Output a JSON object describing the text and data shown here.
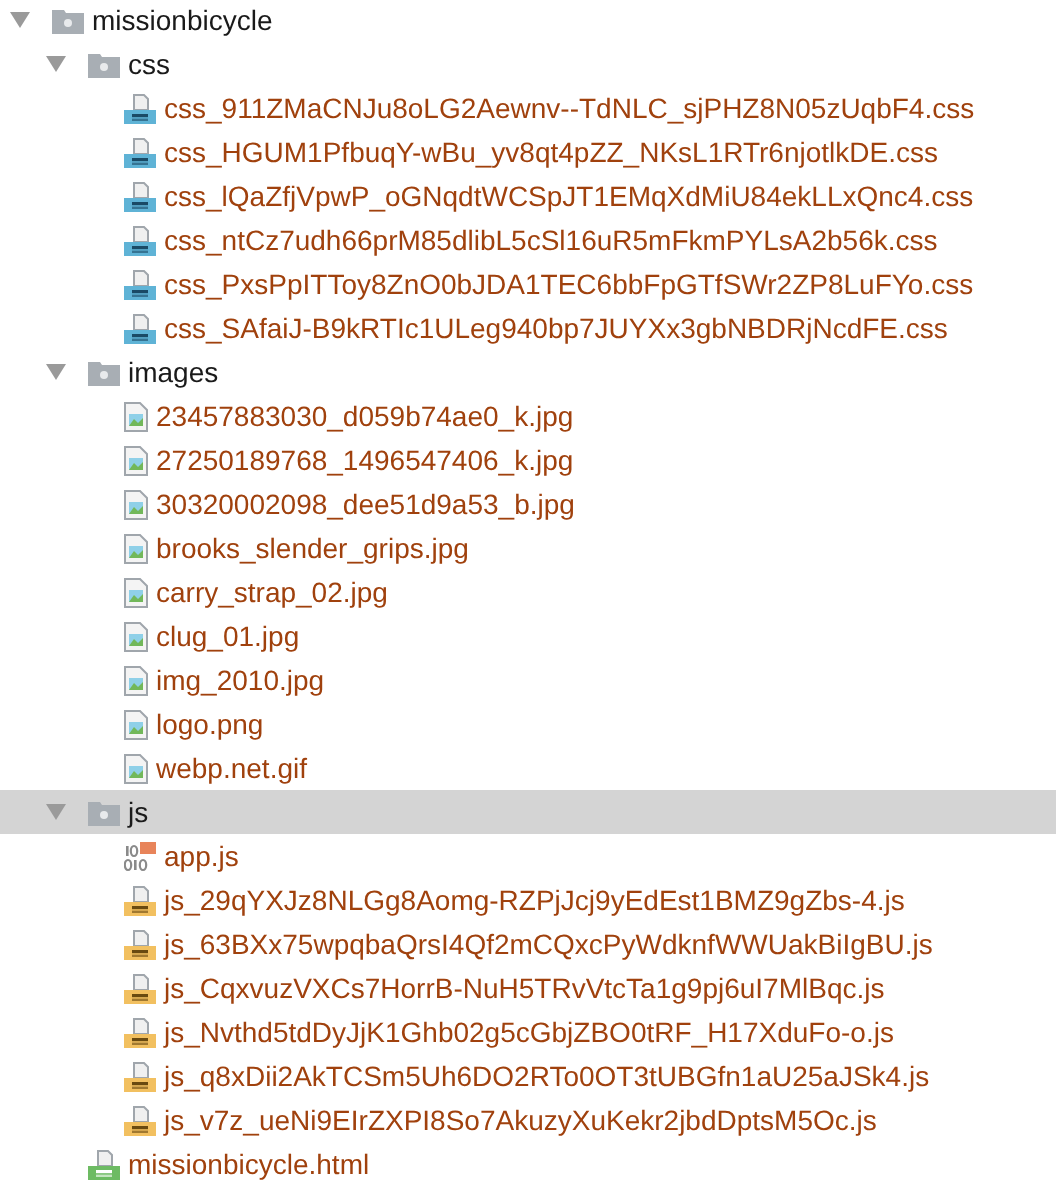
{
  "tree": [
    {
      "kind": "folder",
      "name": "missionbicycle",
      "expanded": true,
      "selected": false,
      "children": [
        {
          "kind": "folder",
          "name": "css",
          "expanded": true,
          "selected": false,
          "children": [
            {
              "kind": "css",
              "name": "css_911ZMaCNJu8oLG2Aewnv--TdNLC_sjPHZ8N05zUqbF4.css",
              "selected": false
            },
            {
              "kind": "css",
              "name": "css_HGUM1PfbuqY-wBu_yv8qt4pZZ_NKsL1RTr6njotlkDE.css",
              "selected": false
            },
            {
              "kind": "css",
              "name": "css_lQaZfjVpwP_oGNqdtWCSpJT1EMqXdMiU84ekLLxQnc4.css",
              "selected": false
            },
            {
              "kind": "css",
              "name": "css_ntCz7udh66prM85dlibL5cSl16uR5mFkmPYLsA2b56k.css",
              "selected": false
            },
            {
              "kind": "css",
              "name": "css_PxsPpITToy8ZnO0bJDA1TEC6bbFpGTfSWr2ZP8LuFYo.css",
              "selected": false
            },
            {
              "kind": "css",
              "name": "css_SAfaiJ-B9kRTIc1ULeg940bp7JUYXx3gbNBDRjNcdFE.css",
              "selected": false
            }
          ]
        },
        {
          "kind": "folder",
          "name": "images",
          "expanded": true,
          "selected": false,
          "children": [
            {
              "kind": "image",
              "name": "23457883030_d059b74ae0_k.jpg",
              "selected": false
            },
            {
              "kind": "image",
              "name": "27250189768_1496547406_k.jpg",
              "selected": false
            },
            {
              "kind": "image",
              "name": "30320002098_dee51d9a53_b.jpg",
              "selected": false
            },
            {
              "kind": "image",
              "name": "brooks_slender_grips.jpg",
              "selected": false
            },
            {
              "kind": "image",
              "name": "carry_strap_02.jpg",
              "selected": false
            },
            {
              "kind": "image",
              "name": "clug_01.jpg",
              "selected": false
            },
            {
              "kind": "image",
              "name": "img_2010.jpg",
              "selected": false
            },
            {
              "kind": "image",
              "name": "logo.png",
              "selected": false
            },
            {
              "kind": "image",
              "name": "webp.net.gif",
              "selected": false
            }
          ]
        },
        {
          "kind": "folder",
          "name": "js",
          "expanded": true,
          "selected": true,
          "children": [
            {
              "kind": "binary-js",
              "name": "app.js",
              "selected": false
            },
            {
              "kind": "js",
              "name": "js_29qYXJz8NLGg8Aomg-RZPjJcj9yEdEst1BMZ9gZbs-4.js",
              "selected": false
            },
            {
              "kind": "js",
              "name": "js_63BXx75wpqbaQrsI4Qf2mCQxcPyWdknfWWUakBiIgBU.js",
              "selected": false
            },
            {
              "kind": "js",
              "name": "js_CqxvuzVXCs7HorrB-NuH5TRvVtcTa1g9pj6uI7MlBqc.js",
              "selected": false
            },
            {
              "kind": "js",
              "name": "js_Nvthd5tdDyJjK1Ghb02g5cGbjZBO0tRF_H17XduFo-o.js",
              "selected": false
            },
            {
              "kind": "js",
              "name": "js_q8xDii2AkTCSm5Uh6DO2RTo0OT3tUBGfn1aU25aJSk4.js",
              "selected": false
            },
            {
              "kind": "js",
              "name": "js_v7z_ueNi9EIrZXPI8So7AkuzyXuKekr2jbdDptsM5Oc.js",
              "selected": false
            }
          ]
        },
        {
          "kind": "html",
          "name": "missionbicycle.html",
          "selected": false
        }
      ]
    }
  ]
}
